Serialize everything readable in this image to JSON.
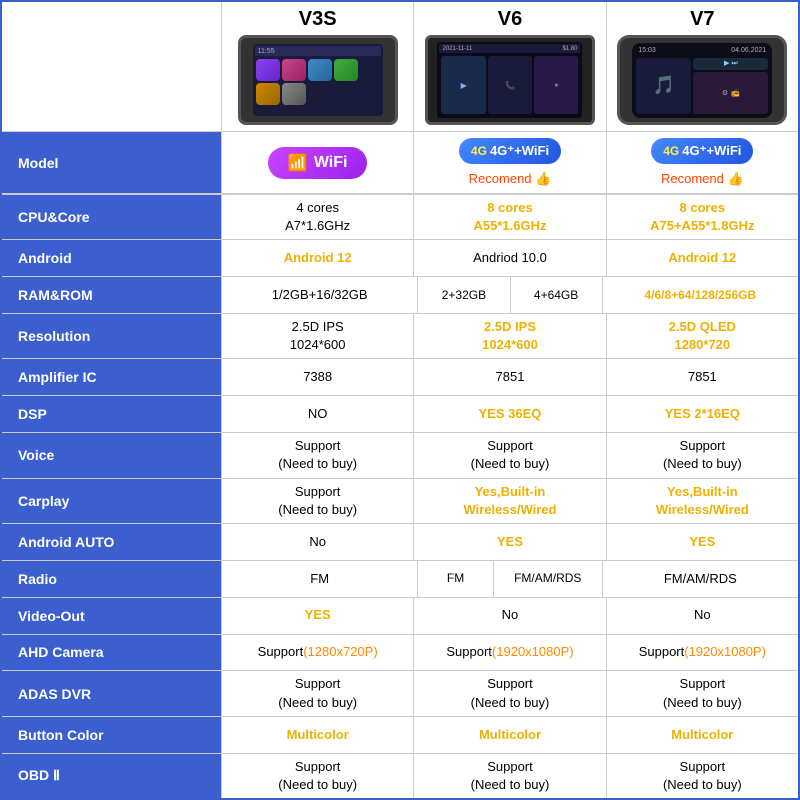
{
  "header": {
    "products": [
      {
        "id": "v3s",
        "title": "V3S"
      },
      {
        "id": "v6",
        "title": "V6"
      },
      {
        "id": "v7",
        "title": "V7"
      }
    ]
  },
  "badges": {
    "v3s": {
      "type": "wifi",
      "label": "WiFi"
    },
    "v6": {
      "type": "4gwifi",
      "label": "4G⁺+WiFi",
      "recommend": "Recomend 👍"
    },
    "v7": {
      "type": "4gwifi",
      "label": "4G⁺+WiFi",
      "recommend": "Recomend 👍"
    }
  },
  "rows": [
    {
      "label": "CPU&Core",
      "v3s": "4 cores\nA7*1.6GHz",
      "v3s_style": "normal",
      "v6": "8 cores\nA55*1.6GHz",
      "v6_style": "yellow",
      "v7": "8 cores\nA75+A55*1.8GHz",
      "v7_style": "yellow"
    },
    {
      "label": "Android",
      "v3s": "Android 12",
      "v3s_style": "yellow",
      "v6": "Andriod 10.0",
      "v6_style": "normal",
      "v7": "Android 12",
      "v7_style": "yellow"
    },
    {
      "label": "RAM&ROM",
      "type": "split",
      "v3s": "1/2GB+16/32GB",
      "v3s_style": "normal",
      "v6_a": "2+32GB",
      "v6_b": "4+64GB",
      "v6_style": "normal",
      "v7": "4/6/8+64/128/256GB",
      "v7_style": "yellow"
    },
    {
      "label": "Resolution",
      "v3s": "2.5D IPS\n1024*600",
      "v3s_style": "normal",
      "v6": "2.5D IPS\n1024*600",
      "v6_style": "yellow",
      "v7": "2.5D QLED\n1280*720",
      "v7_style": "yellow"
    },
    {
      "label": "Amplifier IC",
      "v3s": "7388",
      "v3s_style": "normal",
      "v6": "7851",
      "v6_style": "normal",
      "v7": "7851",
      "v7_style": "normal"
    },
    {
      "label": "DSP",
      "v3s": "NO",
      "v3s_style": "normal",
      "v6": "YES 36EQ",
      "v6_style": "yellow",
      "v7": "YES 2*16EQ",
      "v7_style": "yellow"
    },
    {
      "label": "Voice",
      "v3s": "Support\n(Need to buy)",
      "v3s_style": "normal",
      "v6": "Support\n(Need to buy)",
      "v6_style": "normal",
      "v7": "Support\n(Need to buy)",
      "v7_style": "normal"
    },
    {
      "label": "Carplay",
      "v3s": "Support\n(Need to buy)",
      "v3s_style": "normal",
      "v6": "Yes,Built-in\nWireless/Wired",
      "v6_style": "yellow",
      "v7": "Yes,Built-in\nWireless/Wired",
      "v7_style": "yellow"
    },
    {
      "label": "Android AUTO",
      "v3s": "No",
      "v3s_style": "normal",
      "v6": "YES",
      "v6_style": "yellow",
      "v7": "YES",
      "v7_style": "yellow"
    },
    {
      "label": "Radio",
      "type": "radio_split",
      "v3s": "FM",
      "v3s_style": "normal",
      "v6_a": "FM",
      "v6_b": "FM/AM/RDS",
      "v6_style": "normal",
      "v7": "FM/AM/RDS",
      "v7_style": "normal"
    },
    {
      "label": "Video-Out",
      "v3s": "YES",
      "v3s_style": "yellow",
      "v6": "No",
      "v6_style": "normal",
      "v7": "No",
      "v7_style": "normal"
    },
    {
      "label": "AHD Camera",
      "v3s": "Support\n(1280x720P)",
      "v3s_style": "support_orange",
      "v6": "Support\n(1920x1080P)",
      "v6_style": "support_orange",
      "v7": "Support\n(1920x1080P)",
      "v7_style": "support_orange"
    },
    {
      "label": "ADAS DVR",
      "v3s": "Support\n(Need to buy)",
      "v3s_style": "normal",
      "v6": "Support\n(Need to buy)",
      "v6_style": "normal",
      "v7": "Support\n(Need to buy)",
      "v7_style": "normal"
    },
    {
      "label": "Button Color",
      "v3s": "Multicolor",
      "v3s_style": "yellow",
      "v6": "Multicolor",
      "v6_style": "yellow",
      "v7": "Multicolor",
      "v7_style": "yellow"
    },
    {
      "label": "OBD Ⅱ",
      "v3s": "Support\n(Need to buy)",
      "v3s_style": "normal",
      "v6": "Support\n(Need to buy)",
      "v6_style": "normal",
      "v7": "Support\n(Need to buy)",
      "v7_style": "normal"
    }
  ]
}
